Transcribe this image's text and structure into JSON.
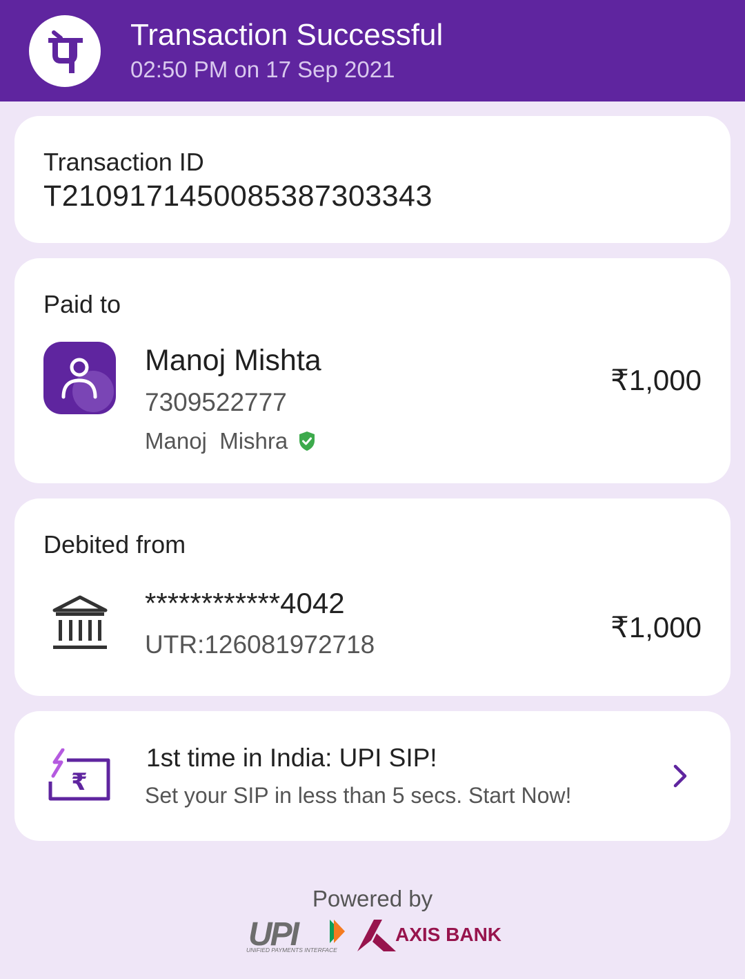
{
  "header": {
    "title": "Transaction Successful",
    "subtitle": "02:50 PM on 17 Sep 2021",
    "logo_icon": "phonepe-logo",
    "logo_glyph": "पे"
  },
  "transaction": {
    "label": "Transaction ID",
    "id": "T2109171450085387303343"
  },
  "paid_to": {
    "label": "Paid to",
    "avatar_icon": "user-avatar-icon",
    "name": "Manoj Mishta",
    "phone": "7309522777",
    "verified_name": "Manoj  Mishra",
    "verified_icon": "verified-shield-icon",
    "amount": "₹1,000"
  },
  "debited_from": {
    "label": "Debited from",
    "bank_icon": "bank-icon",
    "account": "************4042",
    "utr": "UTR:126081972718",
    "amount": "₹1,000"
  },
  "promo": {
    "icon": "sip-rupee-icon",
    "title": "1st time in India: UPI SIP!",
    "subtitle": "Set your SIP in less than 5 secs. Start Now!",
    "chevron_icon": "chevron-right-icon"
  },
  "footer": {
    "powered_by": "Powered by",
    "upi_logo_text": "UPI",
    "upi_tagline": "UNIFIED PAYMENTS INTERFACE",
    "bank_logo_text": "AXIS BANK"
  },
  "colors": {
    "brand_purple": "#5F259F",
    "page_background": "#EFE6F7",
    "verified_green": "#3DAA4C",
    "axis_maroon": "#97144D",
    "upi_orange": "#F47B20",
    "upi_green": "#0F9D58"
  }
}
